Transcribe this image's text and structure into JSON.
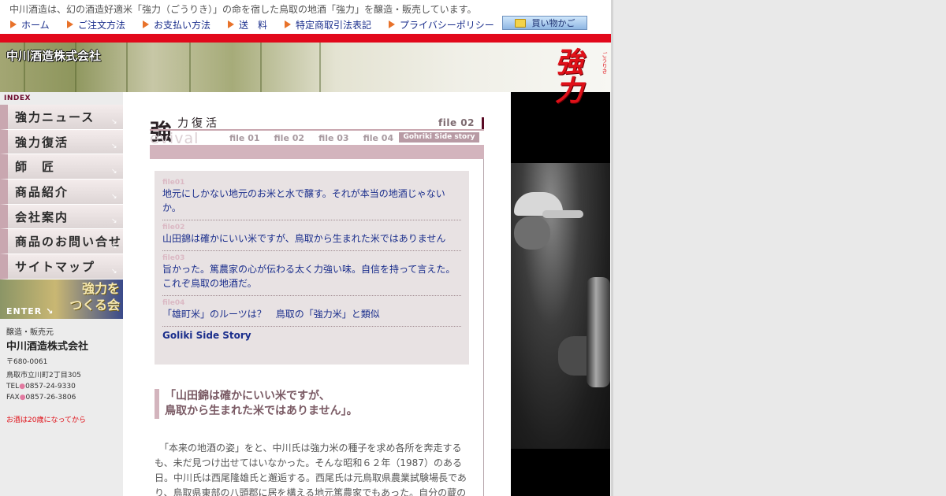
{
  "tagline": "中川酒造は、幻の酒造好適米「強力（ごうりき）」の命を宿した鳥取の地酒「強力」を醸造・販売しています。",
  "topnav": [
    {
      "label": "ホーム"
    },
    {
      "label": "ご注文方法"
    },
    {
      "label": "お支払い方法"
    },
    {
      "label": "送　料"
    },
    {
      "label": "特定商取引法表記"
    },
    {
      "label": "プライバシーポリシー"
    }
  ],
  "cart_label": "買い物かご",
  "banner": {
    "company_logo": "中川酒造株式会社",
    "brand_mark": "強力",
    "brand_ruby": "ごうりき"
  },
  "sidebar": {
    "index_label": "INDEX",
    "items": [
      {
        "label": "強力ニュース"
      },
      {
        "label": "強力復活"
      },
      {
        "label": "師　匠"
      },
      {
        "label": "商品紹介"
      },
      {
        "label": "会社案内"
      },
      {
        "label": "商品のお問い合せ"
      },
      {
        "label": "サイトマップ"
      }
    ],
    "enter_banner": {
      "title_line1": "強力を",
      "title_line2": "つくる会",
      "enter": "ENTER"
    },
    "company": {
      "role": "醸造・販売元",
      "name": "中川酒造株式会社",
      "postal": "〒680-0061",
      "address": "鳥取市立川町2丁目305",
      "tel_label": "TEL",
      "tel": "0857-24-9330",
      "fax_label": "FAX",
      "fax": "0857-26-3806",
      "age_note": "お酒は20歳になってから"
    }
  },
  "heading": {
    "kanji": "強",
    "rest": "力復活",
    "file_label": "file 02",
    "revival": "evival",
    "tabs": [
      "file 01",
      "file 02",
      "file 03",
      "file 04"
    ],
    "side_story": "Gohriki Side story"
  },
  "file_list": [
    {
      "num": "file01",
      "text": "地元にしかない地元のお米と水で醸す。それが本当の地酒じゃないか。"
    },
    {
      "num": "file02",
      "text": "山田錦は確かにいい米ですが、鳥取から生まれた米ではありません"
    },
    {
      "num": "file03",
      "text": "旨かった。篤農家の心が伝わる太く力強い味。自信を持って言えた。これぞ鳥取の地酒だ。"
    },
    {
      "num": "file04",
      "text": "「雄町米」のルーツは？　鳥取の「強力米」と類似"
    }
  ],
  "side_story_link": "Goliki Side Story",
  "quote": {
    "line1": "「山田錦は確かにいい米ですが、",
    "line2": "鳥取から生まれた米ではありません」。"
  },
  "body_text": "　「本来の地酒の姿」をと、中川氏は強力米の種子を求め各所を奔走するも、未だ見つけ出せてはいなかった。そんな昭和６２年（1987）のある日。中川氏は西尾隆雄氏と邂逅する。西尾氏は元鳥取県農業試験場長であり、鳥取県東部の八頭郡に居を構える地元篤農家でもあった。自分の蔵の",
  "colors": {
    "accent_red": "#e2081b",
    "link_blue": "#1a2e8c",
    "pink": "#d3b4bd",
    "nav_triangle": "#e8722a"
  }
}
